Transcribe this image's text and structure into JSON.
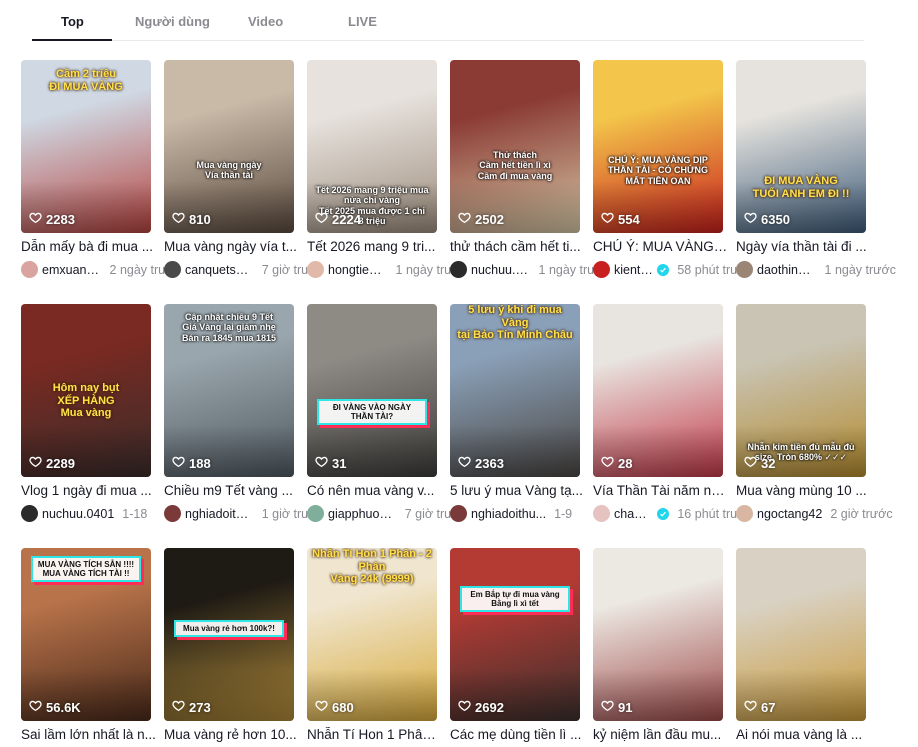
{
  "tabs": [
    {
      "label": "Top"
    },
    {
      "label": "Người dùng"
    },
    {
      "label": "Video"
    },
    {
      "label": "LIVE"
    }
  ],
  "videos": [
    {
      "likes": "2283",
      "caption": "Dẫn mấy bà đi mua ...",
      "user": "emxuan.an...",
      "time": "2 ngày trước",
      "verified": false,
      "overlay": "Cầm 2 triệu\nĐI MUA VÀNG",
      "overlay_style": "yellow",
      "bg": [
        "#cfd8e3",
        "#b5443f"
      ],
      "avatar": "#d9a4a0"
    },
    {
      "likes": "810",
      "caption": "Mua vàng ngày vía t...",
      "user": "canquetsai...",
      "time": "7 giờ trước",
      "verified": false,
      "overlay": "Mua vàng ngày\nVía thần tài",
      "overlay_style": "plain",
      "bg": [
        "#c9b9a7",
        "#5a4a3e"
      ],
      "avatar": "#4a4a4a"
    },
    {
      "likes": "2224",
      "caption": "Tết 2026 mang 9 tri...",
      "user": "hongtieuho...",
      "time": "1 ngày trước",
      "verified": false,
      "overlay": "Tết 2026 mang 9 triệu mua\nnửa chỉ vàng\nTết 2025 mua được 1 chỉ\n8 triệu",
      "overlay_style": "plain",
      "bg": [
        "#e7e2dd",
        "#9c8c7c"
      ],
      "avatar": "#e0b9a8"
    },
    {
      "likes": "2502",
      "caption": "thử thách cầm hết ti...",
      "user": "nuchuu.0401",
      "time": "1 ngày trước",
      "verified": false,
      "overlay": "Thử thách\nCầm hết tiền lì xì\nCầm đi mua vàng",
      "overlay_style": "plain",
      "bg": [
        "#8b3b34",
        "#d5c7a6"
      ],
      "avatar": "#2b2b2b"
    },
    {
      "likes": "554",
      "caption": "CHÚ Ý: MUA VÀNG ...",
      "user": "kienthuckin...",
      "time": "58 phút trước",
      "verified": true,
      "overlay": "CHÚ Ý: MUA VÀNG DỊP THẦN TÀI - CÓ CHỨNG\nMẤT TIỀN OAN",
      "overlay_style": "plain",
      "bg": [
        "#f3c54a",
        "#c8201e"
      ],
      "avatar": "#c8201e"
    },
    {
      "likes": "6350",
      "caption": "Ngày vía thần tài đi ...",
      "user": "daothinhvu...",
      "time": "1 ngày trước",
      "verified": false,
      "overlay": "ĐI MUA VÀNG\nTUỔI ANH EM ĐI !!",
      "overlay_style": "yellow",
      "bg": [
        "#e6e3de",
        "#3e5c7a"
      ],
      "avatar": "#9b8676"
    },
    {
      "likes": "2289",
      "caption": "Vlog 1 ngày đi mua ...",
      "user": "nuchuu.0401",
      "time": "1-18",
      "verified": false,
      "overlay": "Hôm nay bụt\nXẾP HÀNG\nMua vàng",
      "overlay_style": "yellow",
      "bg": [
        "#7a2a22",
        "#3a2c2a"
      ],
      "avatar": "#2b2b2b"
    },
    {
      "likes": "188",
      "caption": "Chiều m9 Tết vàng ...",
      "user": "nghiadoithu...",
      "time": "1 giờ trước",
      "verified": false,
      "overlay": "Cập nhật chiều 9 Tết\nGiá Vàng lại giảm nhẹ\nBán ra 1845 mua 1815",
      "overlay_style": "plain",
      "bg": [
        "#9aa6ad",
        "#4f5960"
      ],
      "avatar": "#7a3a3a"
    },
    {
      "likes": "31",
      "caption": "Có nên mua vàng v...",
      "user": "giapphuong...",
      "time": "7 giờ trước",
      "verified": false,
      "overlay": "ĐI VÀNG VÀO NGÀY THẦN TÀI?",
      "overlay_style": "box",
      "bg": [
        "#8e8a84",
        "#3d3c3a"
      ],
      "avatar": "#7fae9a"
    },
    {
      "likes": "2363",
      "caption": "5 lưu ý mua Vàng tạ...",
      "user": "nghiadoithu...",
      "time": "1-9",
      "verified": false,
      "overlay": "5 lưu ý khi đi mua Vàng\ntại Bảo Tín Minh Châu",
      "overlay_style": "yellow",
      "bg": [
        "#8aa0b8",
        "#4a4643"
      ],
      "avatar": "#7a3a3a"
    },
    {
      "likes": "28",
      "caption": "Vía Thần Tài năm na...",
      "user": "chau_muoi",
      "time": "16 phút trước",
      "verified": true,
      "overlay": "",
      "overlay_style": "plain",
      "bg": [
        "#e8e4df",
        "#c23a4a"
      ],
      "avatar": "#e6c2c0"
    },
    {
      "likes": "32",
      "caption": "Mua vàng mùng 10 ...",
      "user": "ngoctang42",
      "time": "2 giờ trước",
      "verified": false,
      "overlay": "Nhẫn kim tiền đủ mẫu đủ\nsize. Tròn 680% ✓✓✓",
      "overlay_style": "plain",
      "bg": [
        "#c9c4b4",
        "#b38a2e"
      ],
      "avatar": "#d8b6a2"
    },
    {
      "likes": "56.6K",
      "caption": "Sai lầm lớn nhất là n...",
      "user": "",
      "time": "",
      "verified": false,
      "overlay": "MUA VÀNG TÍCH SẴN !!!!\nMUA VÀNG TÍCH TÀI !!",
      "overlay_style": "box",
      "bg": [
        "#b8734a",
        "#4a2a1a"
      ],
      "avatar": "#ffffff"
    },
    {
      "likes": "273",
      "caption": "Mua vàng rẻ hơn 10...",
      "user": "",
      "time": "",
      "verified": false,
      "overlay": "Mua vàng rẻ hơn 100k?!",
      "overlay_style": "box",
      "bg": [
        "#1e1a14",
        "#b08a3a"
      ],
      "avatar": "#ffffff"
    },
    {
      "likes": "680",
      "caption": "Nhẫn Tí Hon 1 Phân ...",
      "user": "",
      "time": "",
      "verified": false,
      "overlay": "Nhẫn Tí Hon 1 Phân - 2 Phân\nVàng 24k (9999)",
      "overlay_style": "yellow",
      "bg": [
        "#f0e6cf",
        "#d7a93a"
      ],
      "avatar": "#ffffff"
    },
    {
      "likes": "2692",
      "caption": "Các mẹ dùng tiền lì ...",
      "user": "",
      "time": "",
      "verified": false,
      "overlay": "Em Bắp tự đi mua vàng\nBằng lì xì tết",
      "overlay_style": "box",
      "bg": [
        "#b43a34",
        "#3b302c"
      ],
      "avatar": "#ffffff"
    },
    {
      "likes": "91",
      "caption": "kỷ niệm lần đầu mu...",
      "user": "",
      "time": "",
      "verified": false,
      "overlay": "",
      "overlay_style": "plain",
      "bg": [
        "#ece8e2",
        "#9e4a4a"
      ],
      "avatar": "#ffffff"
    },
    {
      "likes": "67",
      "caption": "Ai nói mua vàng là ...",
      "user": "",
      "time": "",
      "verified": false,
      "overlay": "",
      "overlay_style": "plain",
      "bg": [
        "#d9d2c4",
        "#c99a3a"
      ],
      "avatar": "#ffffff"
    }
  ]
}
